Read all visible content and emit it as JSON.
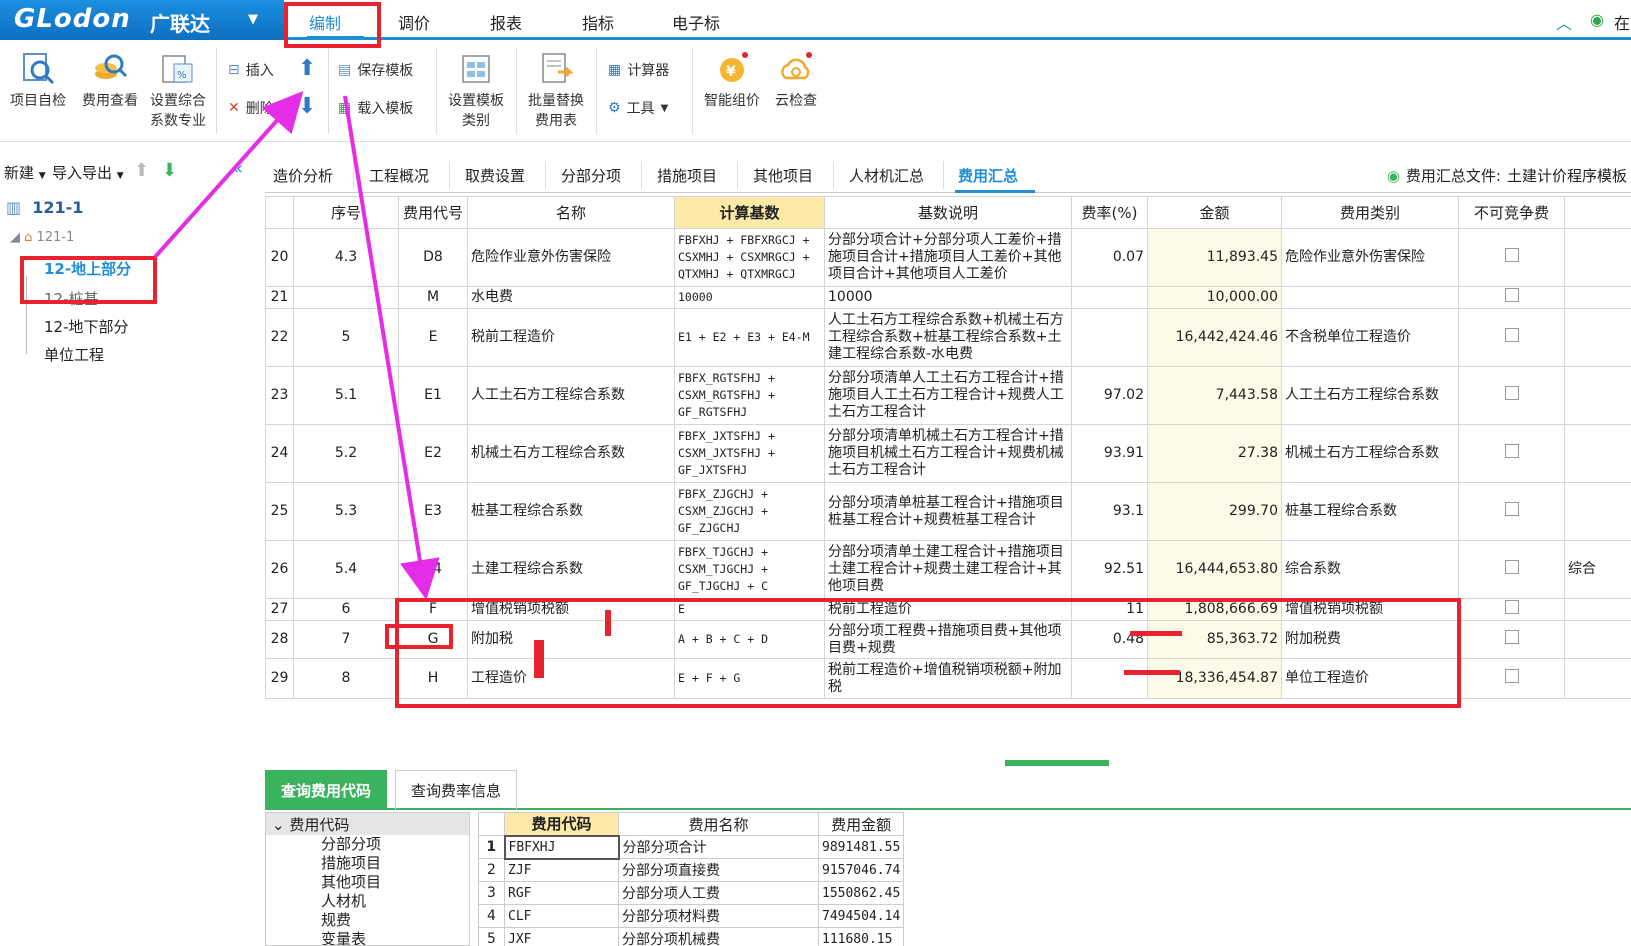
{
  "app": {
    "brand": "GLodon",
    "brand_cn": "广联达"
  },
  "menu": {
    "tabs": [
      "编制",
      "调价",
      "报表",
      "指标",
      "电子标"
    ],
    "active": "编制",
    "right_text": "在"
  },
  "ribbon": {
    "project_check": "项目自检",
    "fee_view": "费用查看",
    "set_coef_line1": "设置综合",
    "set_coef_line2": "系数专业",
    "insert": "插入",
    "delete": "删除",
    "save_template": "保存模板",
    "load_template": "载入模板",
    "set_template_line1": "设置模板",
    "set_template_line2": "类别",
    "batch_replace_line1": "批量替换",
    "batch_replace_line2": "费用表",
    "calculator": "计算器",
    "tools": "工具",
    "smart_price": "智能组价",
    "cloud_check": "云检查"
  },
  "left": {
    "new_label": "新建",
    "import_export": "导入导出",
    "tree": {
      "project": "121-1",
      "sub": "121-1",
      "items": [
        "12-地上部分",
        "12-桩基",
        "12-地下部分",
        "单位工程"
      ],
      "selected": "12-地上部分"
    }
  },
  "content_tabs": [
    "造价分析",
    "工程概况",
    "取费设置",
    "分部分项",
    "措施项目",
    "其他项目",
    "人材机汇总",
    "费用汇总"
  ],
  "active_content_tab": "费用汇总",
  "summary_file": {
    "label": "费用汇总文件:",
    "value": "土建计价程序模板"
  },
  "table": {
    "headers": [
      "",
      "序号",
      "费用代号",
      "名称",
      "计算基数",
      "基数说明",
      "费率(%)",
      "金额",
      "费用类别",
      "不可竞争费",
      ""
    ],
    "rows": [
      {
        "n": "20",
        "seq": "4.3",
        "code": "D8",
        "name": "危险作业意外伤害保险",
        "base": "FBFXHJ + FBFXRGCJ + CSXMHJ + CSXMRGCJ + QTXMHJ + QTXMRGCJ",
        "desc": "分部分项合计+分部分项人工差价+措施项目合计+措施项目人工差价+其他项目合计+其他项目人工差价",
        "rate": "0.07",
        "amount": "11,893.45",
        "cat": "危险作业意外伤害保险",
        "extra": ""
      },
      {
        "n": "21",
        "seq": "",
        "code": "M",
        "name": "水电费",
        "base": "10000",
        "desc": "10000",
        "rate": "",
        "amount": "10,000.00",
        "cat": "",
        "extra": ""
      },
      {
        "n": "22",
        "seq": "5",
        "code": "E",
        "name": "税前工程造价",
        "base": "E1 + E2 + E3 + E4-M",
        "desc": "人工土石方工程综合系数+机械土石方工程综合系数+桩基工程综合系数+土建工程综合系数-水电费",
        "rate": "",
        "amount": "16,442,424.46",
        "cat": "不含税单位工程造价",
        "extra": ""
      },
      {
        "n": "23",
        "seq": "5.1",
        "code": "E1",
        "name": "人工土石方工程综合系数",
        "base": "FBFX_RGTSFHJ + CSXM_RGTSFHJ + GF_RGTSFHJ",
        "desc": "分部分项清单人工土石方工程合计+措施项目人工土石方工程合计+规费人工土石方工程合计",
        "rate": "97.02",
        "amount": "7,443.58",
        "cat": "人工土石方工程综合系数",
        "extra": ""
      },
      {
        "n": "24",
        "seq": "5.2",
        "code": "E2",
        "name": "机械土石方工程综合系数",
        "base": "FBFX_JXTSFHJ + CSXM_JXTSFHJ + GF_JXTSFHJ",
        "desc": "分部分项清单机械土石方工程合计+措施项目机械土石方工程合计+规费机械土石方工程合计",
        "rate": "93.91",
        "amount": "27.38",
        "cat": "机械土石方工程综合系数",
        "extra": ""
      },
      {
        "n": "25",
        "seq": "5.3",
        "code": "E3",
        "name": "桩基工程综合系数",
        "base": "FBFX_ZJGCHJ + CSXM_ZJGCHJ + GF_ZJGCHJ",
        "desc": "分部分项清单桩基工程合计+措施项目桩基工程合计+规费桩基工程合计",
        "rate": "93.1",
        "amount": "299.70",
        "cat": "桩基工程综合系数",
        "extra": ""
      },
      {
        "n": "26",
        "seq": "5.4",
        "code": "E4",
        "name": "土建工程综合系数",
        "base": "FBFX_TJGCHJ + CSXM_TJGCHJ + GF_TJGCHJ + C",
        "desc": "分部分项清单土建工程合计+措施项目土建工程合计+规费土建工程合计+其他项目费",
        "rate": "92.51",
        "amount": "16,444,653.80",
        "cat": "综合系数",
        "extra": "综合"
      },
      {
        "n": "27",
        "seq": "6",
        "code": "F",
        "name": "增值税销项税额",
        "base": "E",
        "desc": "税前工程造价",
        "rate": "11",
        "amount": "1,808,666.69",
        "cat": "增值税销项税额",
        "extra": ""
      },
      {
        "n": "28",
        "seq": "7",
        "code": "G",
        "name": "附加税",
        "base": "A + B + C + D",
        "desc": "分部分项工程费+措施项目费+其他项目费+规费",
        "rate": "0.48",
        "amount": "85,363.72",
        "cat": "附加税费",
        "extra": ""
      },
      {
        "n": "29",
        "seq": "8",
        "code": "H",
        "name": "工程造价",
        "base": "E + F + G",
        "desc": "税前工程造价+增值税销项税额+附加税",
        "rate": "",
        "amount": "18,336,454.87",
        "cat": "单位工程造价",
        "extra": ""
      }
    ]
  },
  "bottom": {
    "tabs": [
      "查询费用代码",
      "查询费率信息"
    ],
    "active_tab": "查询费用代码",
    "tree_root": "费用代码",
    "tree_items": [
      "分部分项",
      "措施项目",
      "其他项目",
      "人材机",
      "规费",
      "变量表"
    ],
    "code_headers": [
      "",
      "费用代码",
      "费用名称",
      "费用金额"
    ],
    "code_rows": [
      {
        "n": "1",
        "code": "FBFXHJ",
        "name": "分部分项合计",
        "amount": "9891481.55"
      },
      {
        "n": "2",
        "code": "ZJF",
        "name": "分部分项直接费",
        "amount": "9157046.74"
      },
      {
        "n": "3",
        "code": "RGF",
        "name": "分部分项人工费",
        "amount": "1550862.45"
      },
      {
        "n": "4",
        "code": "CLF",
        "name": "分部分项材料费",
        "amount": "7494504.14"
      },
      {
        "n": "5",
        "code": "JXF",
        "name": "分部分项机械费",
        "amount": "111680.15"
      }
    ]
  },
  "colors": {
    "accent": "#1e8fd6",
    "green": "#3bb25e",
    "annotation_red": "#e8232f",
    "annotation_arrow": "#e52ce6",
    "highlight_header": "#fde9a8"
  }
}
